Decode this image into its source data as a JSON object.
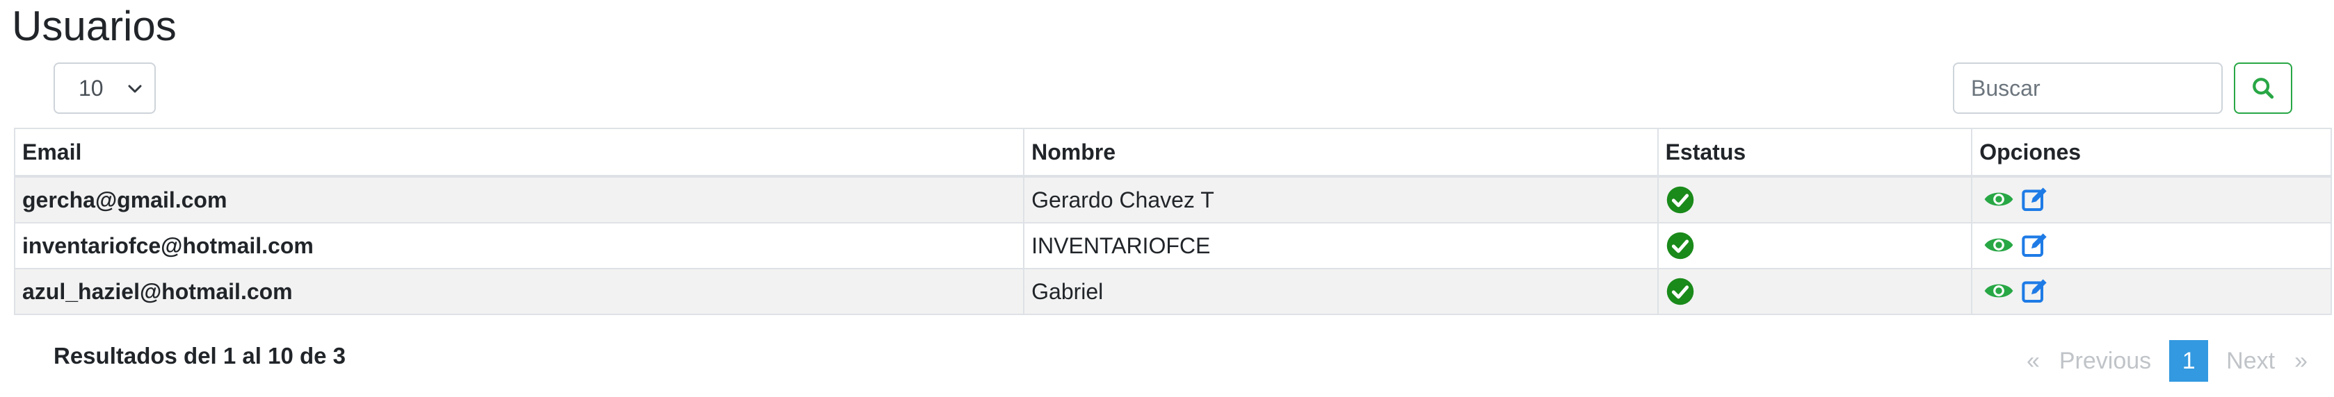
{
  "header": {
    "title": "Usuarios"
  },
  "controls": {
    "page_size": "10",
    "search_placeholder": "Buscar",
    "icons": {
      "chevron": "chevron-down-icon",
      "search": "search-icon"
    }
  },
  "table": {
    "columns": [
      "Email",
      "Nombre",
      "Estatus",
      "Opciones"
    ],
    "rows": [
      {
        "email": "gercha@gmail.com",
        "nombre": "Gerardo Chavez T",
        "estatus": "check-circle-icon"
      },
      {
        "email": "inventariofce@hotmail.com",
        "nombre": "INVENTARIOFCE",
        "estatus": "check-circle-icon"
      },
      {
        "email": "azul_haziel@hotmail.com",
        "nombre": "Gabriel",
        "estatus": "check-circle-icon"
      }
    ]
  },
  "footer": {
    "results_text": "Resultados del 1 al 10 de 3",
    "pagination": {
      "first": "«",
      "previous": "Previous",
      "current": "1",
      "next": "Next",
      "last": "»"
    }
  },
  "colors": {
    "status_ok": "#1a8a1a",
    "view_icon": "#28a745",
    "edit_icon": "#1e7be6",
    "search_border": "#28a745",
    "pagination_active": "#3399e0"
  }
}
